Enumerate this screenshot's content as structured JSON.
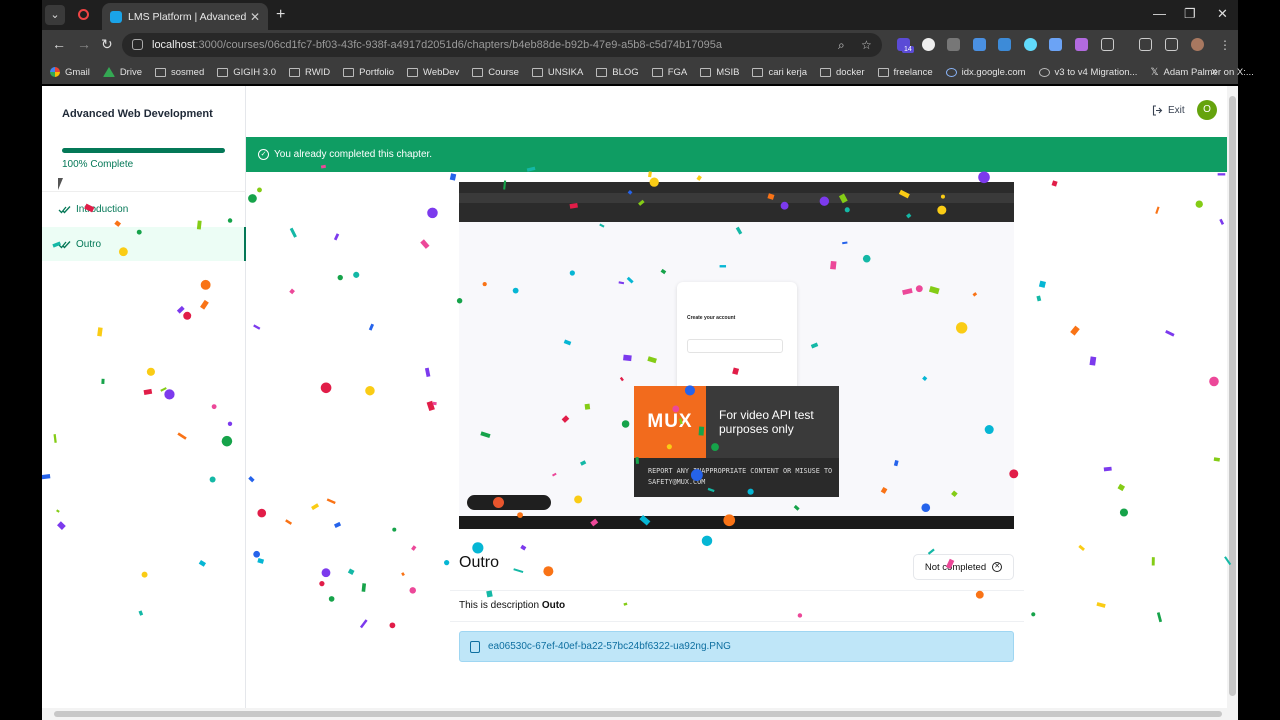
{
  "browser": {
    "tab_title": "LMS Platform | Advanced Web D",
    "url_host": "localhost",
    "url_path": ":3000/courses/06cd1fc7-bf03-43fc-938f-a4917d2051d6/chapters/b4eb88de-b92b-47e9-a5b8-c5d74b17095a",
    "extension_badge": "14",
    "bookmarks": [
      "Gmail",
      "Drive",
      "sosmed",
      "GIGIH 3.0",
      "RWID",
      "Portfolio",
      "WebDev",
      "Course",
      "UNSIKA",
      "BLOG",
      "FGA",
      "MSIB",
      "cari kerja",
      "docker",
      "freelance",
      "idx.google.com",
      "v3 to v4 Migration...",
      "Adam Palmer on X:..."
    ]
  },
  "sidebar": {
    "course_title": "Advanced Web Development",
    "progress_percent": 100,
    "progress_text": "100% Complete",
    "chapters": [
      {
        "label": "Introduction",
        "completed": true,
        "active": false
      },
      {
        "label": "Outro",
        "completed": true,
        "active": true
      }
    ]
  },
  "header": {
    "exit_label": "Exit",
    "avatar_initial": "O"
  },
  "banner": {
    "message": "You already completed this chapter.",
    "color": "#0f9d63"
  },
  "video": {
    "mux_logo": "MUX",
    "mux_message": "For video API test purposes only",
    "mux_warning": "REPORT ANY INAPPROPRIATE CONTENT OR MISUSE TO SAFETY@MUX.COM",
    "inner_card_title": "Create your account"
  },
  "chapter": {
    "title": "Outro",
    "status_button": "Not completed",
    "description_prefix": "This is description",
    "description_bold": "Outo",
    "attachment_name": "ea06530c-67ef-40ef-ba22-57bc24bf6322-ua92ng.PNG"
  },
  "colors": {
    "accent": "#047857",
    "attachment_bg": "#bfe6f8",
    "mux_orange": "#f26b1d"
  }
}
